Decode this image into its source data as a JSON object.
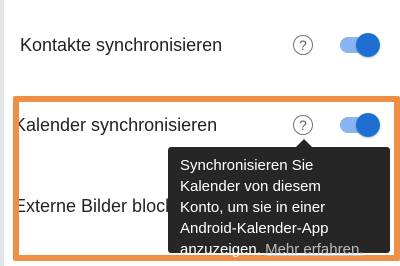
{
  "settings": {
    "rows": [
      {
        "label": "Kontakte synchronisieren",
        "toggle_on": true
      },
      {
        "label": "Kalender synchronisieren",
        "toggle_on": true
      },
      {
        "label": "Externe Bilder blockieren"
      }
    ]
  },
  "tooltip": {
    "lines": [
      "Synchronisieren Sie",
      "Kalender von diesem",
      "Konto, um sie in einer",
      "Android-Kalender-App",
      "anzuzeigen."
    ],
    "link": "Mehr erfahren."
  },
  "icons": {
    "help": "help-circle-icon",
    "help_glyph": "?"
  },
  "colors": {
    "highlight": "#ef8f45",
    "toggle_thumb": "#1f6fd2",
    "toggle_track": "#8ab4f0",
    "tooltip_bg": "#262626"
  }
}
